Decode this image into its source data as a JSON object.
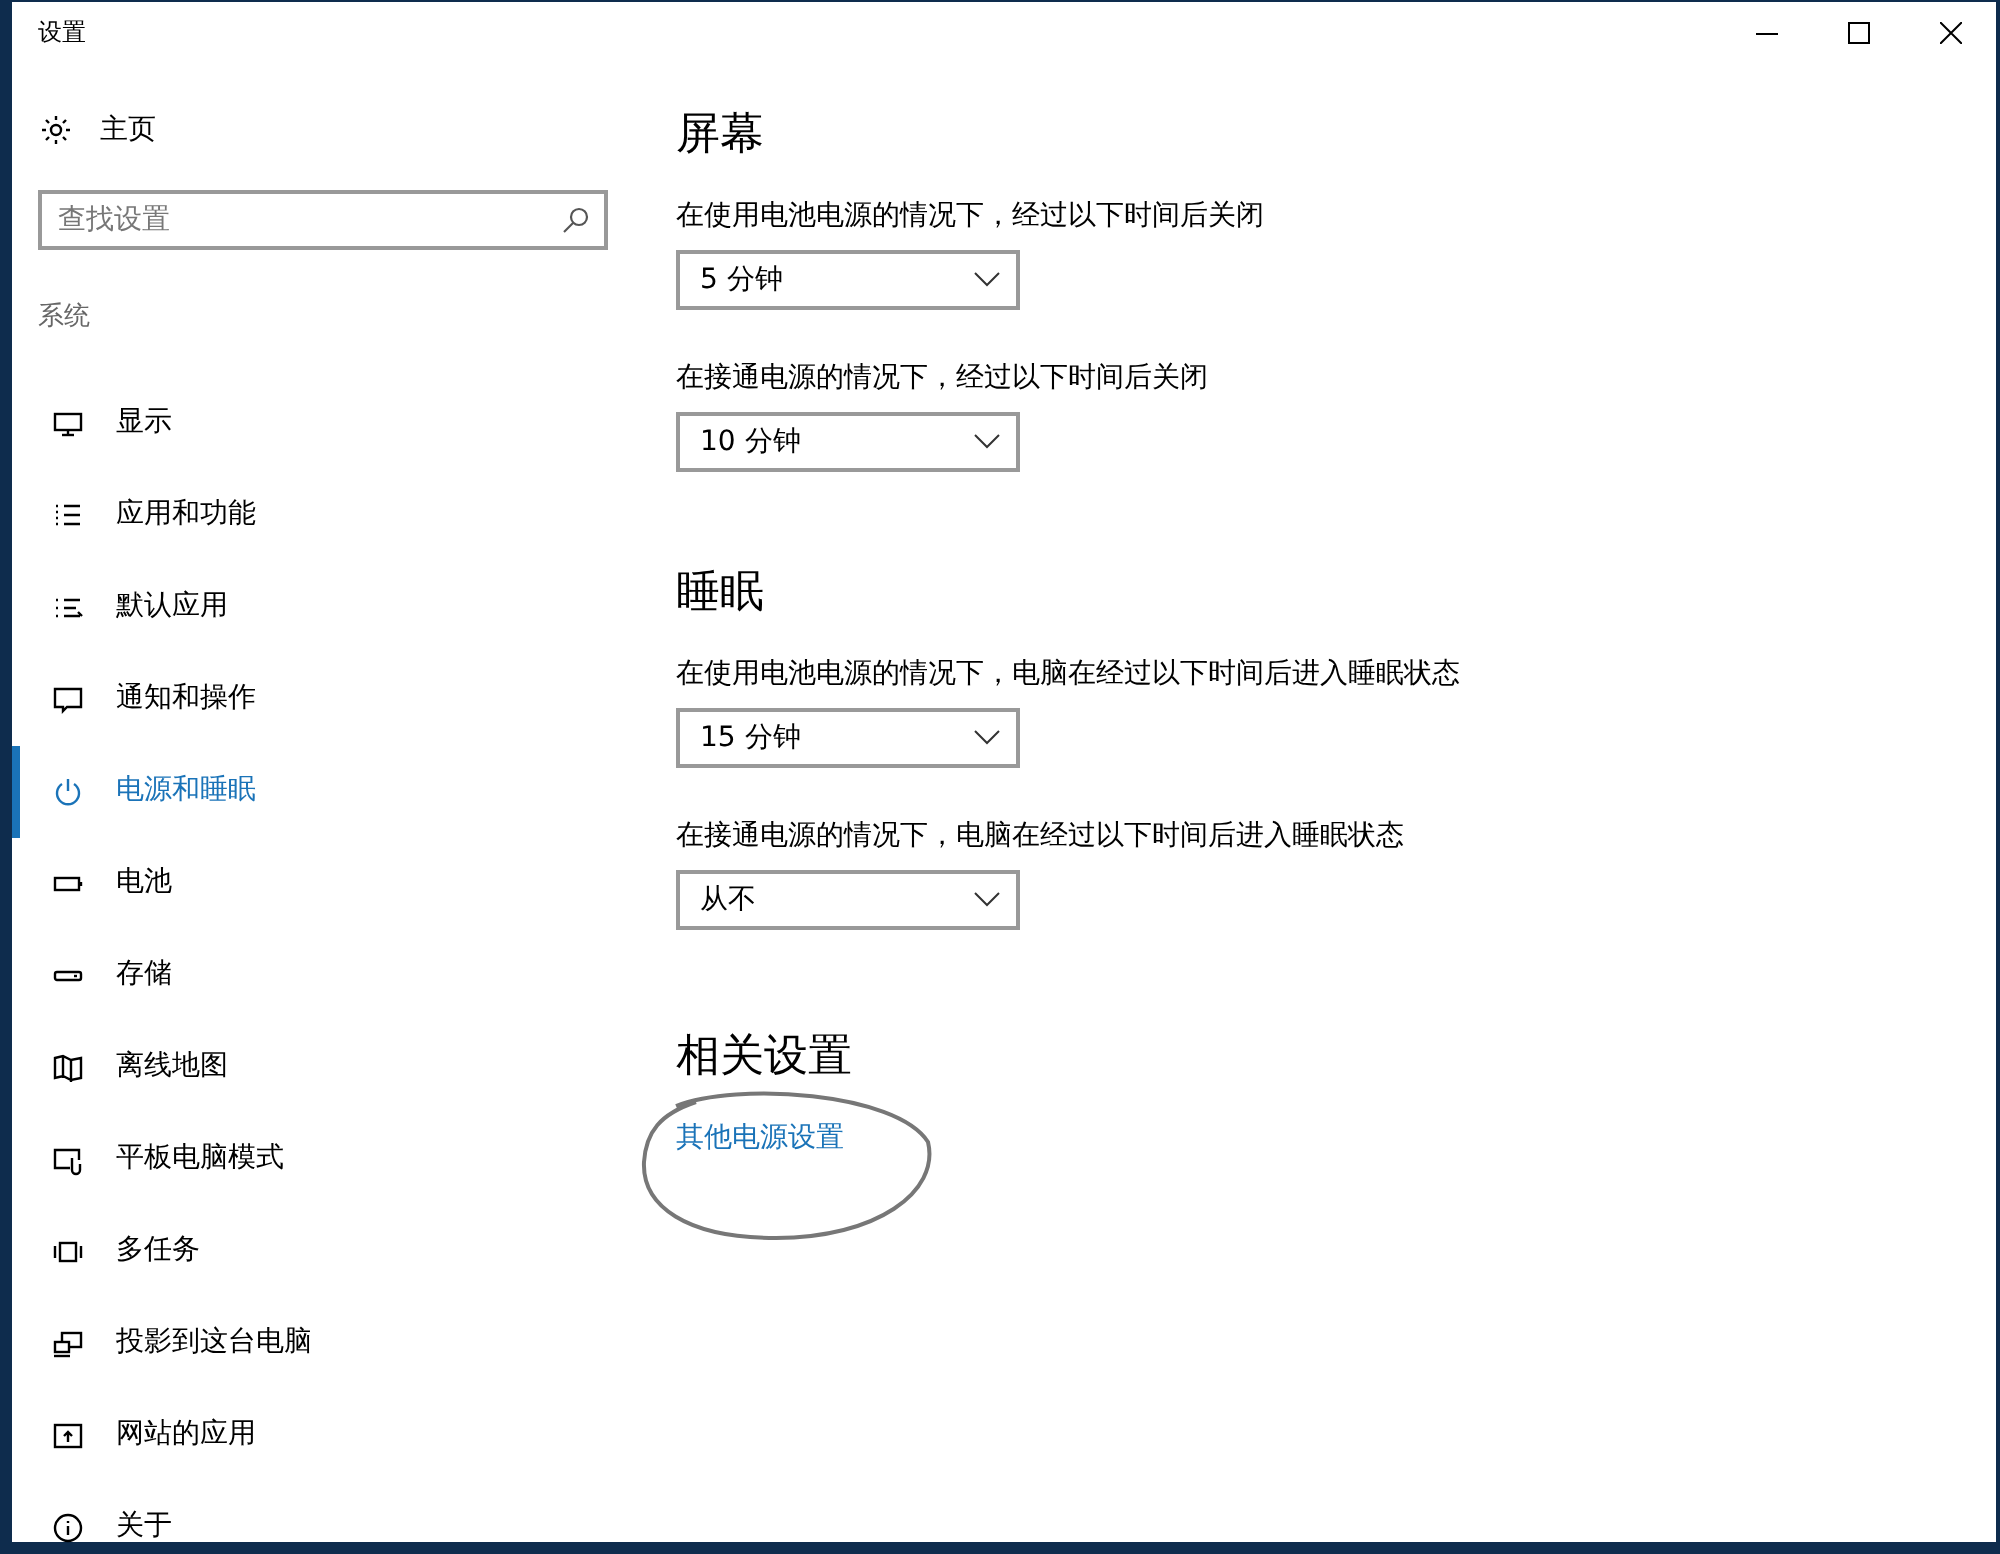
{
  "window": {
    "title": "设置"
  },
  "sidebar": {
    "home": "主页",
    "search": {
      "placeholder": "查找设置"
    },
    "group_label": "系统",
    "items": [
      {
        "label": "显示",
        "selected": false
      },
      {
        "label": "应用和功能",
        "selected": false
      },
      {
        "label": "默认应用",
        "selected": false
      },
      {
        "label": "通知和操作",
        "selected": false
      },
      {
        "label": "电源和睡眠",
        "selected": true
      },
      {
        "label": "电池",
        "selected": false
      },
      {
        "label": "存储",
        "selected": false
      },
      {
        "label": "离线地图",
        "selected": false
      },
      {
        "label": "平板电脑模式",
        "selected": false
      },
      {
        "label": "多任务",
        "selected": false
      },
      {
        "label": "投影到这台电脑",
        "selected": false
      },
      {
        "label": "网站的应用",
        "selected": false
      },
      {
        "label": "关于",
        "selected": false
      }
    ]
  },
  "sections": [
    {
      "title": "屏幕",
      "settings": [
        {
          "label": "在使用电池电源的情况下，经过以下时间后关闭",
          "value": "5 分钟"
        },
        {
          "label": "在接通电源的情况下，经过以下时间后关闭",
          "value": "10 分钟"
        }
      ]
    },
    {
      "title": "睡眠",
      "settings": [
        {
          "label": "在使用电池电源的情况下，电脑在经过以下时间后进入睡眠状态",
          "value": "15 分钟"
        },
        {
          "label": "在接通电源的情况下，电脑在经过以下时间后进入睡眠状态",
          "value": "从不"
        }
      ]
    }
  ],
  "related": {
    "title": "相关设置",
    "links": [
      "其他电源设置"
    ]
  }
}
